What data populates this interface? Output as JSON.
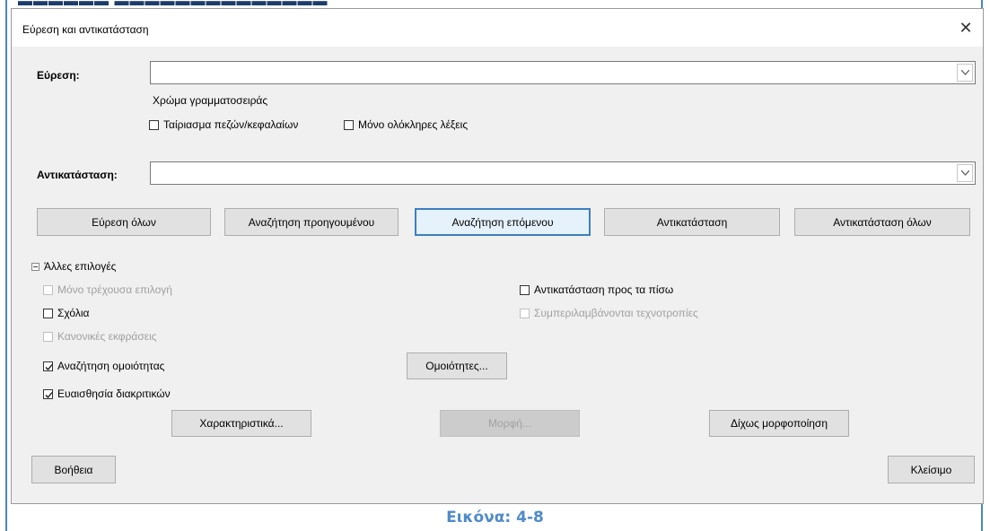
{
  "dialog": {
    "title": "Εύρεση και αντικατάσταση",
    "close_icon": "close-icon"
  },
  "find": {
    "label": "Εύρεση:",
    "value": "",
    "attribute_note": "Χρώμα γραμματοσειράς",
    "match_case": {
      "label": "Ταίριασμα πεζών/κεφαλαίων",
      "checked": false
    },
    "whole_words": {
      "label": "Μόνο ολόκληρες λέξεις",
      "checked": false
    }
  },
  "replace": {
    "label": "Αντικατάσταση:",
    "value": ""
  },
  "buttons": {
    "find_all": "Εύρεση όλων",
    "find_previous": "Αναζήτηση προηγουμένου",
    "find_next": "Αναζήτηση επόμενου",
    "replace": "Αντικατάσταση",
    "replace_all": "Αντικατάσταση όλων"
  },
  "other_options": {
    "header": "Άλλες επιλογές",
    "current_selection_only": {
      "label": "Μόνο τρέχουσα επιλογή",
      "checked": false,
      "enabled": false
    },
    "replace_backwards": {
      "label": "Αντικατάσταση προς τα πίσω",
      "checked": false,
      "enabled": true
    },
    "comments": {
      "label": "Σχόλια",
      "checked": false,
      "enabled": true
    },
    "include_styles": {
      "label": "Συμπεριλαμβάνονται τεχνοτροπίες",
      "checked": false,
      "enabled": false
    },
    "regular_expressions": {
      "label": "Κανονικές εκφράσεις",
      "checked": false,
      "enabled": false
    },
    "similarity_search": {
      "label": "Αναζήτηση ομοιότητας",
      "checked": true,
      "enabled": true
    },
    "similarities_button": "Ομοιότητες...",
    "diacritics_sensitive": {
      "label": "Ευαισθησία διακριτικών",
      "checked": true,
      "enabled": true
    },
    "attributes_button": "Χαρακτηριστικά...",
    "format_button": "Μορφή...",
    "no_format_button": "Δίχως μορφοποίηση"
  },
  "footer": {
    "help": "Βοήθεια",
    "close": "Κλείσιμο"
  },
  "caption": "Εικόνα: 4-8",
  "colors": {
    "accent": "#3c7fc0",
    "caption": "#4f8ac9",
    "frame": "#4a86c8"
  }
}
